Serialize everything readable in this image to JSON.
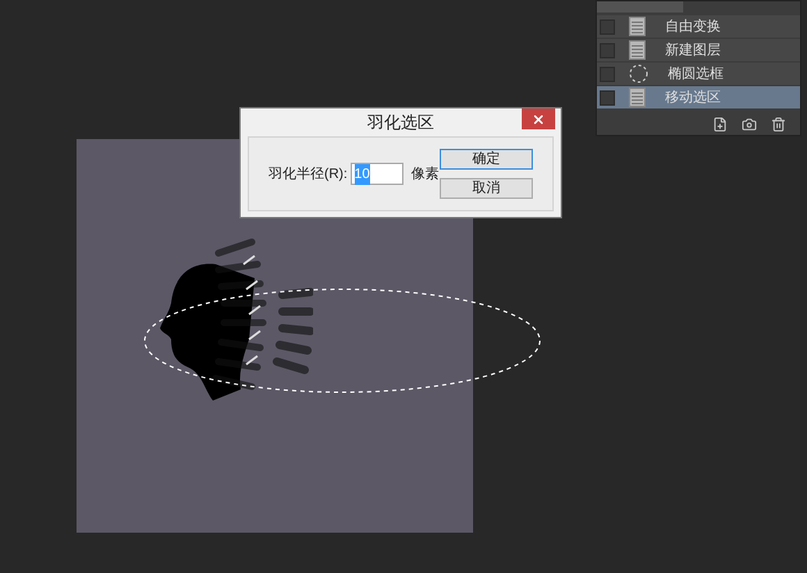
{
  "dialog": {
    "title": "羽化选区",
    "field": {
      "label": "羽化半径(R):",
      "value": "10",
      "value_selected": true
    },
    "unit": "像素",
    "buttons": [
      {
        "label": "确定",
        "default": true
      },
      {
        "label": "取消",
        "default": false
      }
    ]
  },
  "history_panel": {
    "items": [
      {
        "label": "自由变换",
        "kind": "document",
        "selected": false
      },
      {
        "label": "新建图层",
        "kind": "document",
        "selected": false
      },
      {
        "label": "椭圆选框",
        "kind": "ellipse",
        "selected": false
      },
      {
        "label": "移动选区",
        "kind": "document",
        "selected": true
      }
    ]
  }
}
